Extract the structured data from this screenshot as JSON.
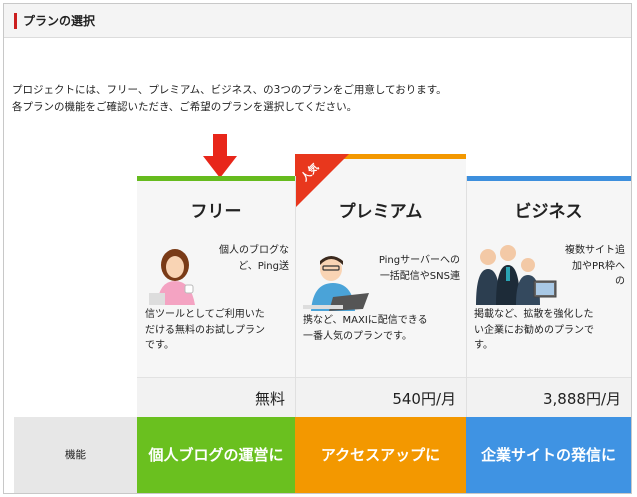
{
  "section": {
    "title": "プランの選択"
  },
  "intro": {
    "line1": "プロジェクトには、フリー、プレミアム、ビジネス、の3つのプランをご用意しております。",
    "line2": "各プランの機能をご確認いただき、ご希望のプランを選択してください。"
  },
  "badge": {
    "popular": "人気"
  },
  "plans": [
    {
      "name": "フリー",
      "illus_text": "個人のブログなど、Ping送",
      "body_lines": [
        "信ツールとしてご利用いた",
        "だける無料のお試しプラン",
        "です。"
      ],
      "price": "無料",
      "feature": "個人ブログの運営に",
      "accent": "#66bb1e"
    },
    {
      "name": "プレミアム",
      "illus_text": "Pingサーバーへの一括配信やSNS連",
      "body_lines": [
        "携など、MAXIに配信できる",
        "一番人気のプランです。"
      ],
      "price": "540円/月",
      "feature": "アクセスアップに",
      "accent": "#f39800"
    },
    {
      "name": "ビジネス",
      "illus_text": "複数サイト追加やPR枠への",
      "body_lines": [
        "掲載など、拡散を強化した",
        "い企業にお勧めのプランで",
        "す。"
      ],
      "price": "3,888円/月",
      "feature": "企業サイトの発信に",
      "accent": "#3d8fdd"
    }
  ],
  "features_row": {
    "label": "機能"
  },
  "colors": {
    "section_accent": "#cc1f1f",
    "arrow": "#e8261a",
    "ribbon": "#e8371d"
  },
  "icons": {
    "arrow": "down-arrow-icon"
  }
}
